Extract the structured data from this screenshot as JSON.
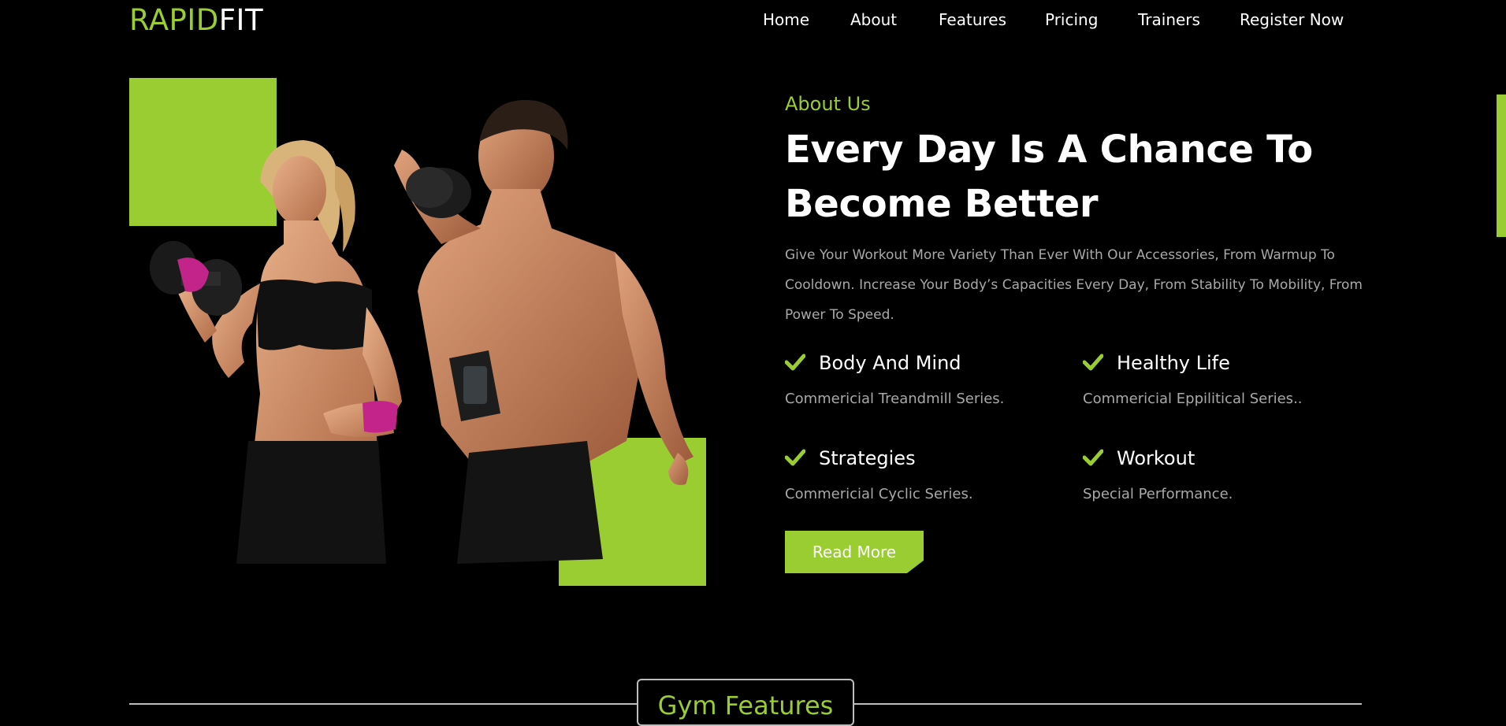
{
  "brand": {
    "logo_part1": "RAPID",
    "logo_part2": "FIT",
    "accent_color": "#9ACD32"
  },
  "nav": {
    "items": [
      {
        "label": "Home"
      },
      {
        "label": "About"
      },
      {
        "label": "Features"
      },
      {
        "label": "Pricing"
      },
      {
        "label": "Trainers"
      },
      {
        "label": "Register Now"
      }
    ]
  },
  "hero_image": {
    "description_icon": "fitness-couple-photo"
  },
  "about": {
    "eyebrow": "About Us",
    "title_line1": "Every Day Is A Chance To",
    "title_line2": "Become Better",
    "description": "Give Your Workout More Variety Than Ever With Our Accessories, From Warmup To Cooldown. Increase Your Body’s Capacities Every Day, From Stability To Mobility, From Power To Speed.",
    "features": [
      {
        "title": "Body And Mind",
        "subtitle": "Commericial Treandmill Series.",
        "icon": "check-icon"
      },
      {
        "title": "Healthy Life",
        "subtitle": "Commericial Eppilitical Series..",
        "icon": "check-icon"
      },
      {
        "title": "Strategies",
        "subtitle": "Commericial Cyclic Series.",
        "icon": "check-icon"
      },
      {
        "title": "Workout",
        "subtitle": "Special Performance.",
        "icon": "check-icon"
      }
    ],
    "button_label": "Read More"
  },
  "section": {
    "heading": "Gym Features"
  }
}
